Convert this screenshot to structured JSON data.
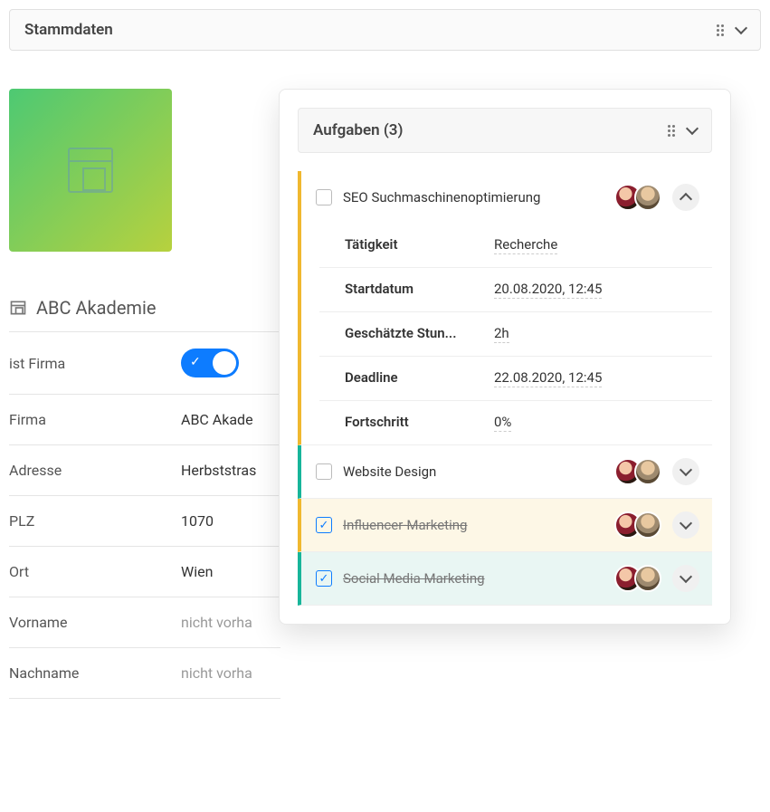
{
  "header": {
    "title": "Stammdaten"
  },
  "company": {
    "name": "ABC Akademie",
    "fields": [
      {
        "label": "ist Firma",
        "type": "toggle",
        "on": true
      },
      {
        "label": "Firma",
        "value": "ABC Akade"
      },
      {
        "label": "Adresse",
        "value": "Herbststras"
      },
      {
        "label": "PLZ",
        "value": "1070"
      },
      {
        "label": "Ort",
        "value": "Wien"
      },
      {
        "label": "Vorname",
        "value": "nicht vorha",
        "placeholder": true
      },
      {
        "label": "Nachname",
        "value": "nicht vorha",
        "placeholder": true
      }
    ]
  },
  "tasks": {
    "title": "Aufgaben (3)",
    "items": [
      {
        "title": "SEO Suchmaschinenoptimierung",
        "done": false,
        "expanded": true,
        "color": "yellow",
        "details": [
          {
            "label": "Tätigkeit",
            "value": "Recherche"
          },
          {
            "label": "Startdatum",
            "value": "20.08.2020, 12:45"
          },
          {
            "label": "Geschätzte Stun...",
            "value": "2h"
          },
          {
            "label": "Deadline",
            "value": "22.08.2020, 12:45"
          },
          {
            "label": "Fortschritt",
            "value": "0%"
          }
        ]
      },
      {
        "title": "Website Design",
        "done": false,
        "expanded": false,
        "color": "green"
      },
      {
        "title": "Influencer-Marketing",
        "done": true,
        "expanded": false,
        "color": "yellow"
      },
      {
        "title": "Social Media Marketing",
        "done": true,
        "expanded": false,
        "color": "green"
      }
    ]
  }
}
